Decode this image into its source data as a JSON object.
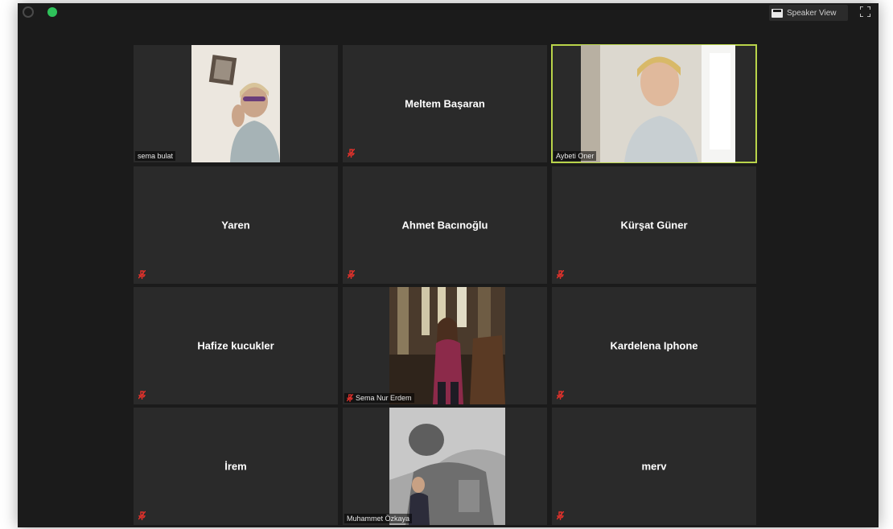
{
  "toolbar": {
    "speaker_view_label": "Speaker View"
  },
  "participants": [
    {
      "name": "sema bulat",
      "video": true,
      "muted": false
    },
    {
      "name": "Meltem Başaran",
      "video": false,
      "muted": true
    },
    {
      "name": "Aybeti Oner",
      "video": true,
      "muted": false,
      "active_speaker": true
    },
    {
      "name": "Yaren",
      "video": false,
      "muted": true
    },
    {
      "name": "Ahmet Bacınoğlu",
      "video": false,
      "muted": true
    },
    {
      "name": "Kürşat Güner",
      "video": false,
      "muted": true
    },
    {
      "name": "Hafize kucukler",
      "video": false,
      "muted": true
    },
    {
      "name": "Sema Nur Erdem",
      "video": true,
      "muted": true
    },
    {
      "name": "Kardelena Iphone",
      "video": false,
      "muted": true
    },
    {
      "name": "İrem",
      "video": false,
      "muted": true
    },
    {
      "name": "Muhammet Özkaya",
      "video": true,
      "muted": false
    },
    {
      "name": "merv",
      "video": false,
      "muted": true
    }
  ],
  "colors": {
    "active_speaker_border": "#b9d44a",
    "muted_icon": "#e0312b",
    "encryption_dot": "#2ec25a"
  }
}
